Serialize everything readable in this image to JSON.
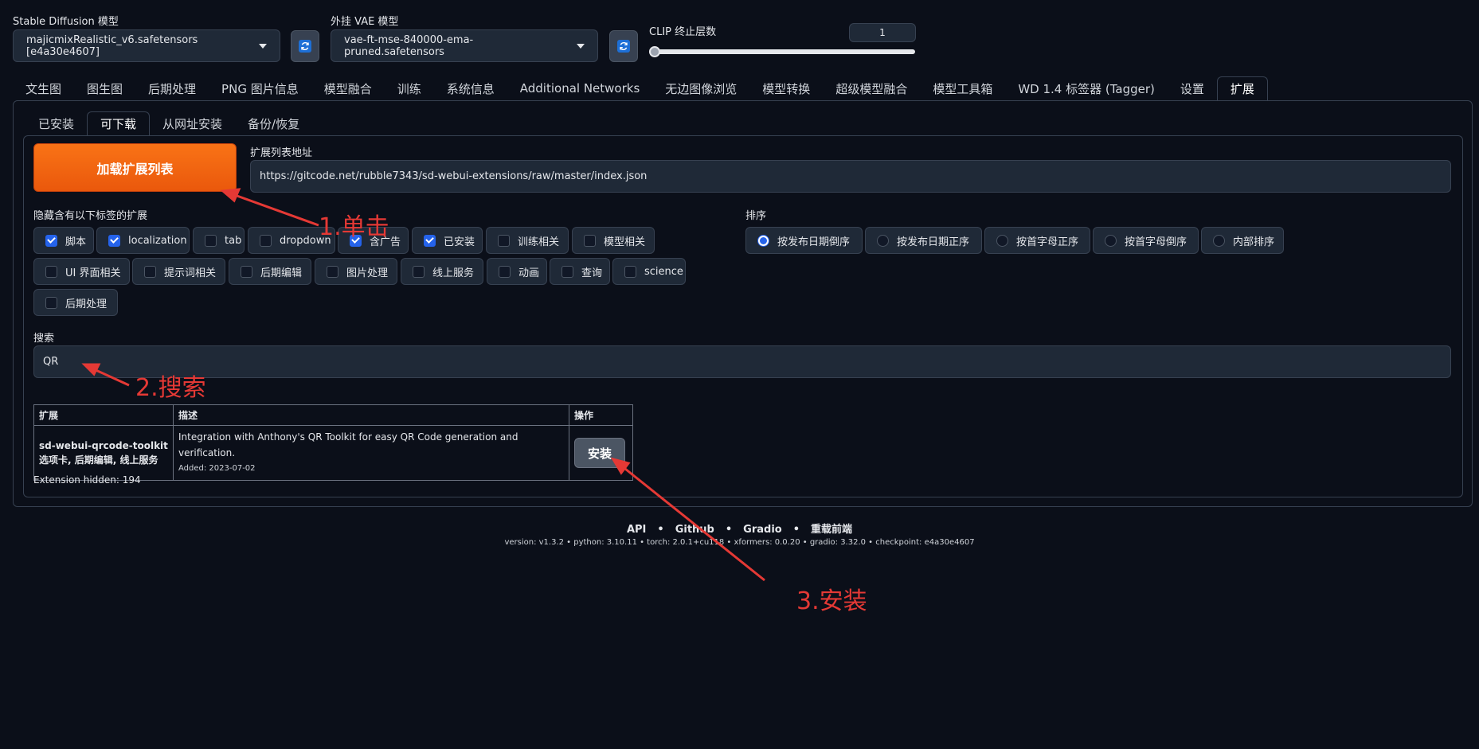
{
  "header": {
    "sd_model_label": "Stable Diffusion 模型",
    "sd_model_value": "majicmixRealistic_v6.safetensors [e4a30e4607]",
    "vae_label": "外挂 VAE 模型",
    "vae_value": "vae-ft-mse-840000-ema-pruned.safetensors",
    "clip_label": "CLIP 终止层数",
    "clip_value": "1"
  },
  "main_tabs": [
    {
      "label": "文生图"
    },
    {
      "label": "图生图"
    },
    {
      "label": "后期处理"
    },
    {
      "label": "PNG 图片信息"
    },
    {
      "label": "模型融合"
    },
    {
      "label": "训练"
    },
    {
      "label": "系统信息"
    },
    {
      "label": "Additional Networks"
    },
    {
      "label": "无边图像浏览"
    },
    {
      "label": "模型转换"
    },
    {
      "label": "超级模型融合"
    },
    {
      "label": "模型工具箱"
    },
    {
      "label": "WD 1.4 标签器 (Tagger)"
    },
    {
      "label": "设置"
    },
    {
      "label": "扩展"
    }
  ],
  "sub_tabs": [
    {
      "label": "已安装"
    },
    {
      "label": "可下载"
    },
    {
      "label": "从网址安装"
    },
    {
      "label": "备份/恢复"
    }
  ],
  "load_button": "加载扩展列表",
  "url_label": "扩展列表地址",
  "url_value": "https://gitcode.net/rubble7343/sd-webui-extensions/raw/master/index.json",
  "hide_label": "隐藏含有以下标签的扩展",
  "hide_tags": [
    {
      "label": "脚本",
      "checked": true
    },
    {
      "label": "localization",
      "checked": true
    },
    {
      "label": "tab",
      "checked": false
    },
    {
      "label": "dropdown",
      "checked": false
    },
    {
      "label": "含广告",
      "checked": true
    },
    {
      "label": "已安装",
      "checked": true
    },
    {
      "label": "训练相关",
      "checked": false
    },
    {
      "label": "模型相关",
      "checked": false
    },
    {
      "label": "UI 界面相关",
      "checked": false
    },
    {
      "label": "提示词相关",
      "checked": false
    },
    {
      "label": "后期编辑",
      "checked": false
    },
    {
      "label": "图片处理",
      "checked": false
    },
    {
      "label": "线上服务",
      "checked": false
    },
    {
      "label": "动画",
      "checked": false
    },
    {
      "label": "查询",
      "checked": false
    },
    {
      "label": "science",
      "checked": false
    },
    {
      "label": "后期处理",
      "checked": false
    }
  ],
  "sort_label": "排序",
  "sort_options": [
    {
      "label": "按发布日期倒序",
      "selected": true
    },
    {
      "label": "按发布日期正序",
      "selected": false
    },
    {
      "label": "按首字母正序",
      "selected": false
    },
    {
      "label": "按首字母倒序",
      "selected": false
    },
    {
      "label": "内部排序",
      "selected": false
    }
  ],
  "search_label": "搜索",
  "search_value": "QR",
  "table": {
    "headers": [
      "扩展",
      "描述",
      "操作"
    ],
    "rows": [
      {
        "name": "sd-webui-qrcode-toolkit",
        "tags": "选项卡, 后期编辑, 线上服务",
        "description": "Integration with Anthony's QR Toolkit for easy QR Code generation and verification.",
        "added": "Added: 2023-07-02",
        "action": "安装"
      }
    ]
  },
  "hidden_count": "Extension hidden: 194",
  "footer": {
    "links": [
      "API",
      "Github",
      "Gradio",
      "重载前端"
    ],
    "version": "version: v1.3.2  •  python: 3.10.11  •  torch: 2.0.1+cu118  •  xformers: 0.0.20  •  gradio: 3.32.0  •  checkpoint: e4a30e4607"
  },
  "annotations": {
    "step1": "1.单击",
    "step2": "2.搜索",
    "step3": "3.安装",
    "color": "#e53935"
  }
}
